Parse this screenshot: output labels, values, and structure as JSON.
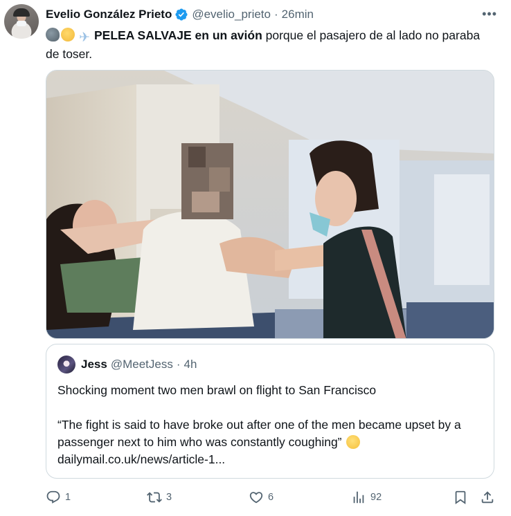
{
  "tweet": {
    "author": {
      "display_name": "Evelio González Prieto",
      "handle": "@evelio_prieto",
      "verified": true
    },
    "separator": "·",
    "time": "26min",
    "text_bold": "PELEA SALVAJE en un avión",
    "text_rest": " porque el pasajero de al lado no paraba de toser.",
    "emojis": [
      "speaking-head-emoji",
      "grimacing-face-emoji",
      "airplane-emoji"
    ]
  },
  "quoted": {
    "display_name": "Jess",
    "handle": "@MeetJess",
    "separator": "·",
    "time": "4h",
    "line1": "Shocking moment two men brawl on flight to San Francisco",
    "line2": "“The fight is said to have broke out after one of the men became upset by a passenger next to him who was constantly coughing”",
    "link": "dailymail.co.uk/news/article-1..."
  },
  "actions": {
    "replies": "1",
    "retweets": "3",
    "likes": "6",
    "views": "92"
  },
  "colors": {
    "text": "#0f1419",
    "secondary": "#536471",
    "border": "#cfd9de",
    "verified": "#1d9bf0"
  }
}
